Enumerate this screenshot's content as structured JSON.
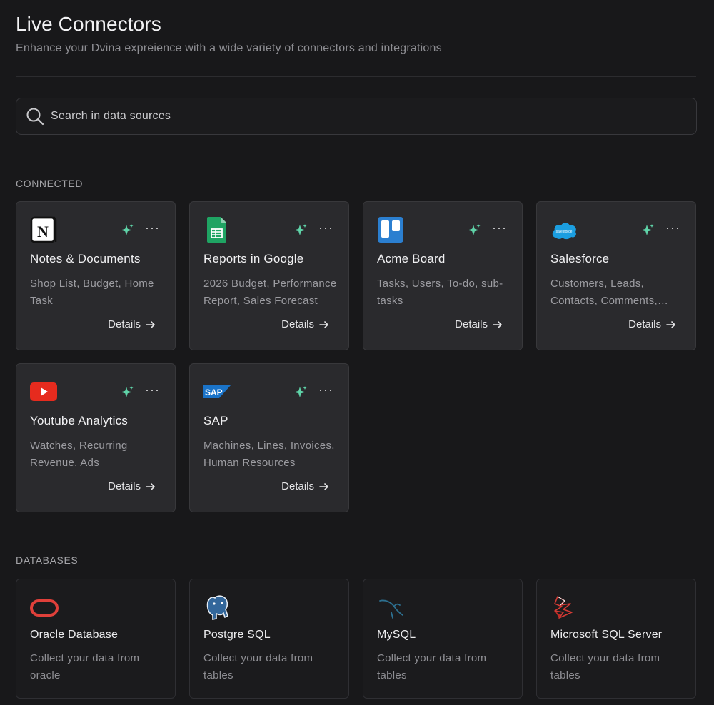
{
  "header": {
    "title": "Live Connectors",
    "subtitle": "Enhance your Dvina expreience with a wide variety of connectors and integrations"
  },
  "search": {
    "placeholder": "Search in data sources"
  },
  "sections": {
    "connected": "CONNECTED",
    "databases": "DATABASES"
  },
  "connected": [
    {
      "name": "Notes & Documents",
      "desc": "Shop List, Budget, Home Task",
      "details": "Details",
      "icon": "notion-icon"
    },
    {
      "name": "Reports in Google",
      "desc": "2026 Budget, Performance Report, Sales Forecast",
      "details": "Details",
      "icon": "google-sheets-icon"
    },
    {
      "name": "Acme Board",
      "desc": "Tasks, Users, To-do, sub-tasks",
      "details": "Details",
      "icon": "trello-icon"
    },
    {
      "name": "Salesforce",
      "desc": "Customers, Leads, Contacts, Comments, Opportunities",
      "details": "Details",
      "icon": "salesforce-icon"
    },
    {
      "name": "Youtube Analytics",
      "desc": "Watches, Recurring Revenue, Ads",
      "details": "Details",
      "icon": "youtube-icon"
    },
    {
      "name": "SAP",
      "desc": "Machines, Lines, Invoices, Human Resources",
      "details": "Details",
      "icon": "sap-icon"
    }
  ],
  "databases": [
    {
      "name": "Oracle Database",
      "desc": "Collect your data from oracle",
      "icon": "oracle-icon"
    },
    {
      "name": "Postgre SQL",
      "desc": "Collect your data from tables",
      "icon": "postgresql-icon"
    },
    {
      "name": "MySQL",
      "desc": "Collect your data from tables",
      "icon": "mysql-icon"
    },
    {
      "name": "Microsoft SQL Server",
      "desc": "Collect your data from tables",
      "icon": "sql-server-icon"
    }
  ],
  "logo_text": {
    "salesforce": "salesforce",
    "sap": "SAP"
  },
  "colors": {
    "accent_spark": "#5fd3a8",
    "background": "#18181a",
    "card": "#2a2a2d"
  }
}
